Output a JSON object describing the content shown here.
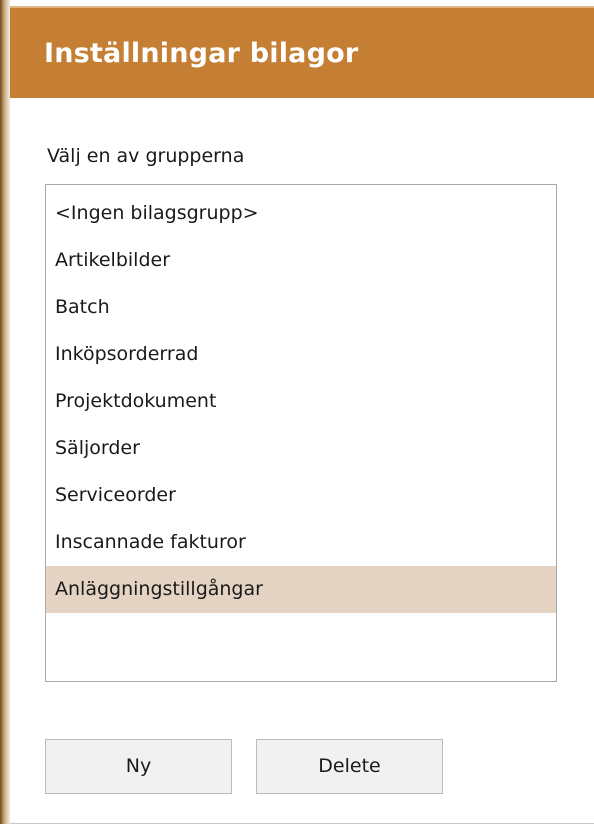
{
  "dialog": {
    "title": "Inställningar bilagor",
    "prompt": "Välj en av grupperna"
  },
  "list": {
    "items": [
      "<Ingen bilagsgrupp>",
      "Artikelbilder",
      "Batch",
      "Inköpsorderrad",
      "Projektdokument",
      "Säljorder",
      "Serviceorder",
      "Inscannade fakturor",
      "Anläggningstillgångar"
    ],
    "selected_item": "Anläggningstillgångar"
  },
  "buttons": {
    "new_label": "Ny",
    "delete_label": "Delete"
  },
  "colors": {
    "titlebar": "#c47f35",
    "title_text": "#ffffff",
    "selection": "#e5d4c3"
  }
}
